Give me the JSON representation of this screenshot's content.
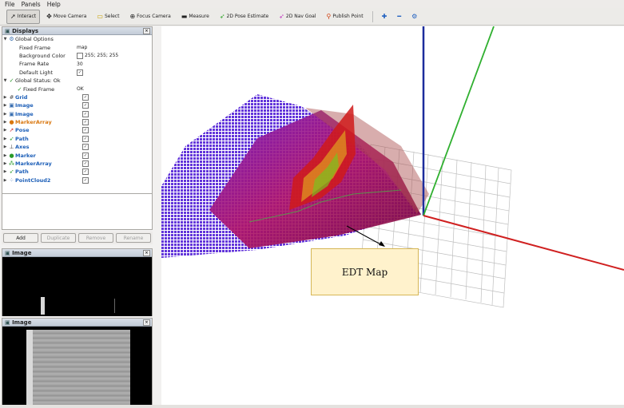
{
  "menu": {
    "file": "File",
    "panels": "Panels",
    "help": "Help"
  },
  "toolbar": {
    "interact": "Interact",
    "move_camera": "Move Camera",
    "select": "Select",
    "focus_camera": "Focus Camera",
    "measure": "Measure",
    "pose_estimate": "2D Pose Estimate",
    "nav_goal": "2D Nav Goal",
    "publish_point": "Publish Point"
  },
  "displays": {
    "title": "Displays",
    "global_options": "Global Options",
    "fixed_frame_label": "Fixed Frame",
    "fixed_frame_value": "map",
    "bg_label": "Background Color",
    "bg_value": "255; 255; 255",
    "frame_rate_label": "Frame Rate",
    "frame_rate_value": "30",
    "default_light_label": "Default Light",
    "global_status": "Global Status: Ok",
    "fixed_frame_status_label": "Fixed Frame",
    "fixed_frame_status_value": "OK",
    "items": [
      {
        "name": "Grid",
        "color": "blue"
      },
      {
        "name": "Image",
        "color": "blue"
      },
      {
        "name": "Image",
        "color": "blue"
      },
      {
        "name": "MarkerArray",
        "color": "orange"
      },
      {
        "name": "Pose",
        "color": "blue"
      },
      {
        "name": "Path",
        "color": "blue"
      },
      {
        "name": "Axes",
        "color": "blue"
      },
      {
        "name": "Marker",
        "color": "blue"
      },
      {
        "name": "MarkerArray",
        "color": "blue"
      },
      {
        "name": "Path",
        "color": "blue"
      },
      {
        "name": "PointCloud2",
        "color": "blue"
      }
    ]
  },
  "buttons": {
    "add": "Add",
    "duplicate": "Duplicate",
    "remove": "Remove",
    "rename": "Rename"
  },
  "image_panel_1": {
    "title": "Image"
  },
  "image_panel_2": {
    "title": "Image"
  },
  "callout": {
    "text": "EDT Map"
  }
}
